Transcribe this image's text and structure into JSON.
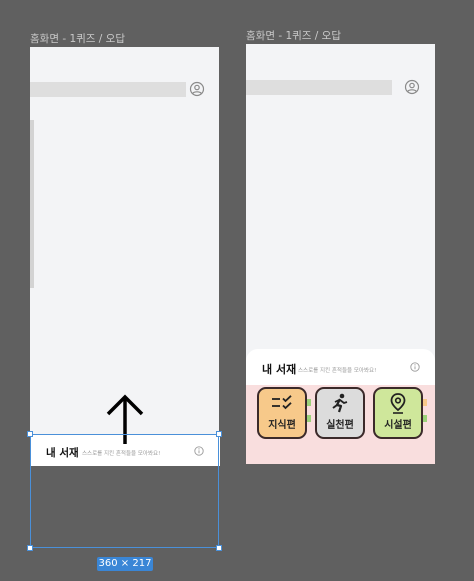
{
  "frames": {
    "left_title": "홈화면 - 1퀴즈 / 오답",
    "right_title": "홈화면 - 1퀴즈 / 오답"
  },
  "sheet": {
    "title": "내 서재",
    "subtitle": "스스로를 지킨 흔적들을 모아봐요!"
  },
  "cards": [
    {
      "label": "지식편",
      "icon": "list-check-icon",
      "color": "#f7c98a"
    },
    {
      "label": "실천편",
      "icon": "running-person-icon",
      "color": "#dcdcdc"
    },
    {
      "label": "시설편",
      "icon": "location-pin-icon",
      "color": "#cfe79b"
    }
  ],
  "selection": {
    "dimensions": "360 × 217"
  },
  "colors": {
    "canvas": "#606060",
    "frame_bg": "#f3f4f6",
    "selection_blue": "#4a90d9",
    "sheet_pink": "#f9dede"
  }
}
